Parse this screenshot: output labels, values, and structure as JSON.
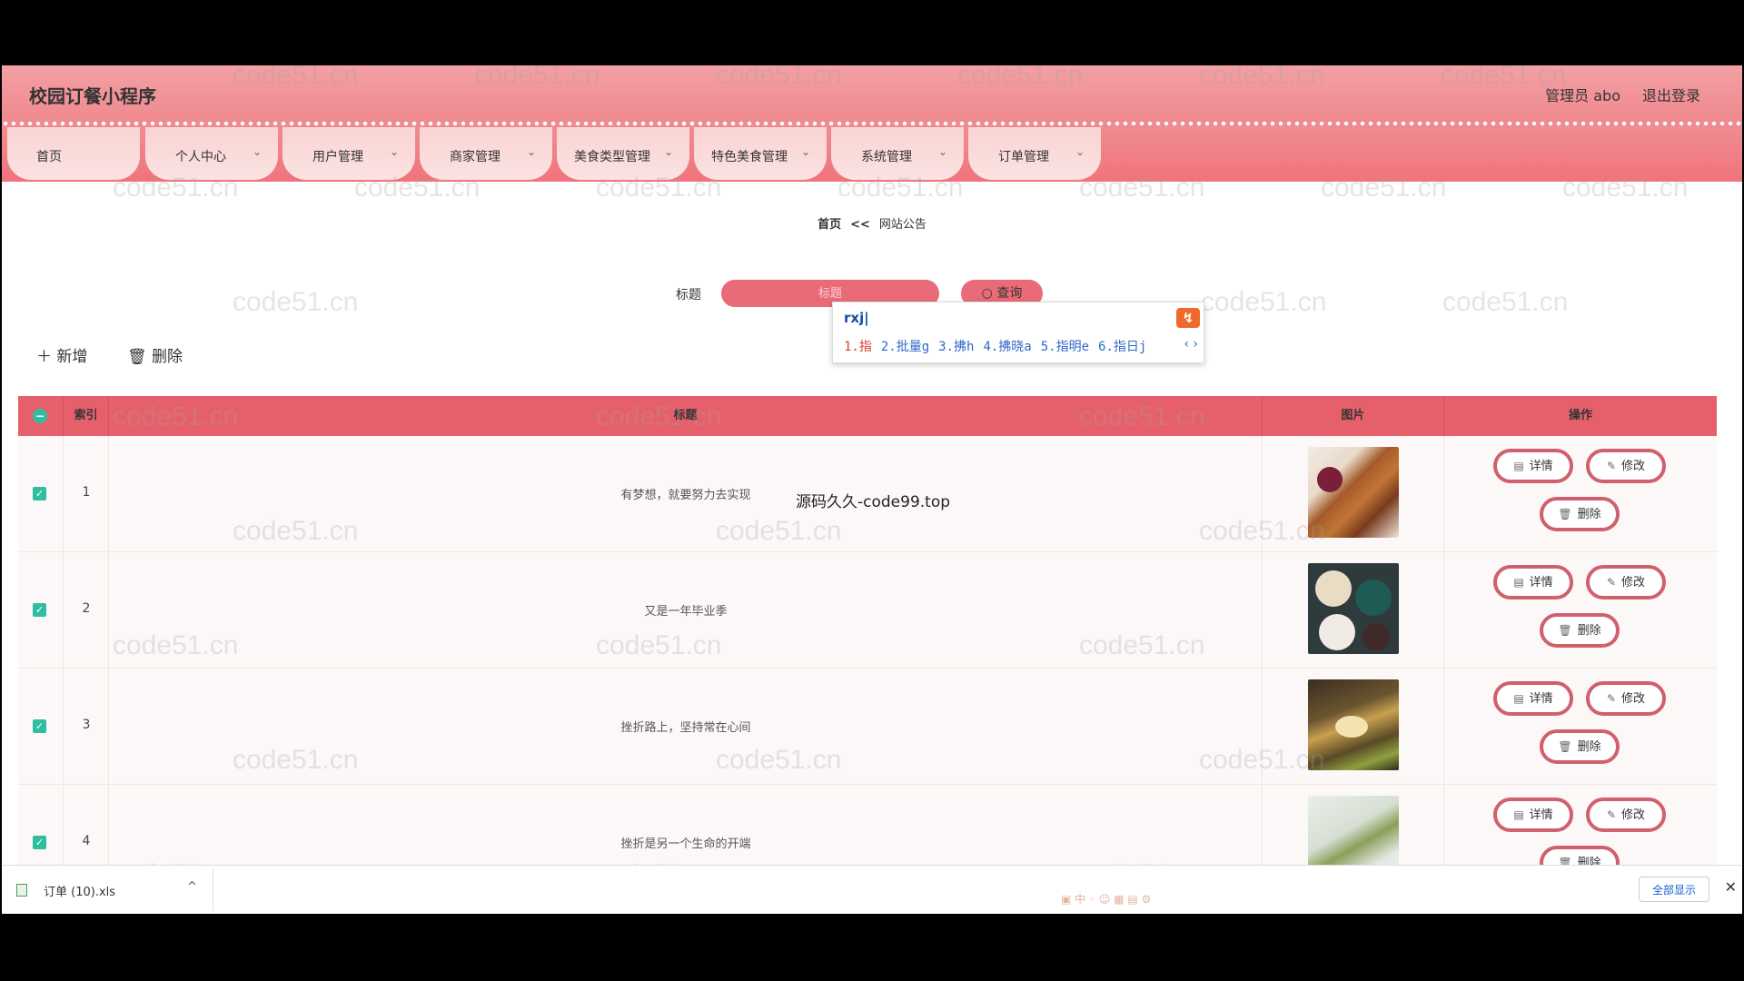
{
  "header": {
    "app_title": "校园订餐小程序",
    "admin_label": "管理员 abo",
    "logout_label": "退出登录"
  },
  "nav": {
    "items": [
      {
        "label": "首页",
        "has_dropdown": false
      },
      {
        "label": "个人中心",
        "has_dropdown": true
      },
      {
        "label": "用户管理",
        "has_dropdown": true
      },
      {
        "label": "商家管理",
        "has_dropdown": true
      },
      {
        "label": "美食类型管理",
        "has_dropdown": true
      },
      {
        "label": "特色美食管理",
        "has_dropdown": true
      },
      {
        "label": "系统管理",
        "has_dropdown": true
      },
      {
        "label": "订单管理",
        "has_dropdown": true
      }
    ]
  },
  "breadcrumb": {
    "home": "首页",
    "separator": "<<",
    "current": "网站公告"
  },
  "search": {
    "label": "标题",
    "placeholder": "标题",
    "button_label": "查询"
  },
  "ime": {
    "input": "rxj",
    "candidates": [
      "1.指",
      "2.批量g",
      "3.拂h",
      "4.拂晓a",
      "5.指明e",
      "6.指日j"
    ],
    "arrows": "‹ ›"
  },
  "toolbar": {
    "add_label": "新增",
    "delete_label": "删除"
  },
  "overlay_text": "源码久久-code99.top",
  "table": {
    "columns": {
      "index": "索引",
      "title": "标题",
      "image": "图片",
      "actions": "操作"
    },
    "rows": [
      {
        "index": "1",
        "title": "有梦想，就要努力去实现",
        "checked": true
      },
      {
        "index": "2",
        "title": "又是一年毕业季",
        "checked": true
      },
      {
        "index": "3",
        "title": "挫折路上，坚持常在心间",
        "checked": true
      },
      {
        "index": "4",
        "title": "挫折是另一个生命的开端",
        "checked": true
      }
    ],
    "actions": {
      "detail": "详情",
      "edit": "修改",
      "delete": "删除"
    }
  },
  "download_bar": {
    "file_name": "订单 (10).xls",
    "show_all": "全部显示"
  },
  "watermark": "code51.cn",
  "colors": {
    "primary": "#ea6b78",
    "header": "#ef8a90",
    "table_header": "#e6606b",
    "check": "#2fbfa0"
  }
}
